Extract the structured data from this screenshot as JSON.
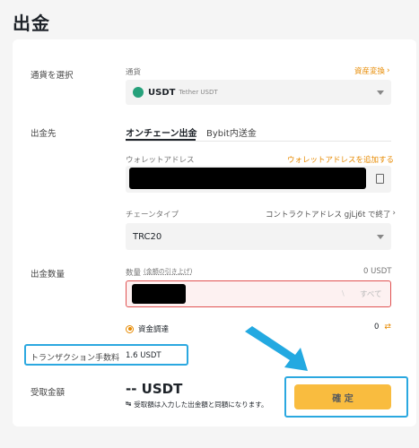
{
  "page": {
    "title": "出金"
  },
  "currency_row": {
    "label": "通貨を選択",
    "field_label": "通貨",
    "convert_link": "資産変換",
    "selected_code": "USDT",
    "selected_name": "Tether USDT"
  },
  "destination_row": {
    "label": "出金先",
    "tabs": [
      "オンチェーン出金",
      "Bybit内送金"
    ],
    "wallet_address_label": "ウォレットアドレス",
    "add_wallet_link": "ウォレットアドレスを追加する",
    "chain_type_label": "チェーンタイプ",
    "contract_address_text": "コントラクトアドレス gjLj6t で終了",
    "chain_value": "TRC20"
  },
  "amount_row": {
    "label": "出金数量",
    "qty_label": "数量",
    "qty_sub": "(金額の引き上げ)",
    "available": "0 USDT",
    "all_button": "すべて",
    "funding_label": "資金調達",
    "funding_value": "0"
  },
  "fee": {
    "label": "トランザクション手数料",
    "value": "1.6 USDT"
  },
  "received_row": {
    "label": "受取金額",
    "amount": "-- USDT",
    "note": "受取額は入力した出金額と同額になります。"
  },
  "confirm_button": "確 定",
  "colors": {
    "accent": "#e78a00",
    "primary_button": "#f7a600",
    "highlight": "#2ba8e0",
    "usdt": "#26a17b"
  },
  "icons": [
    "usdt-coin-icon",
    "chevron-right-icon",
    "chevron-down-icon",
    "paste-icon",
    "radio-selected-icon",
    "swap-icon",
    "arrow-annotation"
  ]
}
